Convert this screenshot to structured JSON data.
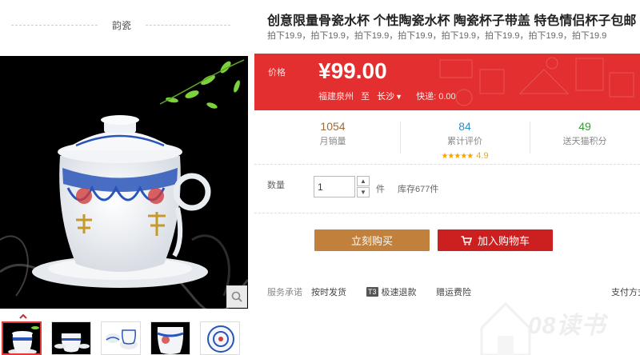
{
  "store": {
    "name": "韵瓷"
  },
  "product": {
    "title": "创意限量骨瓷水杯 个性陶瓷水杯 陶瓷杯子带盖 特色情侣杯子包邮",
    "subtitle": "拍下19.9，拍下19.9，拍下19.9，拍下19.9，拍下19.9，拍下19.9，拍下19.9，拍下19.9"
  },
  "price": {
    "label": "价格",
    "value": "¥99.00",
    "origin": "福建泉州",
    "to": "至",
    "destination": "长沙",
    "express": "快递: 0.00"
  },
  "stats": {
    "monthly_sales": {
      "value": "1054",
      "label": "月销量"
    },
    "reviews": {
      "value": "84",
      "label": "累计评价",
      "stars": "★★★★★",
      "rating": "4.9"
    },
    "points": {
      "value": "49",
      "label": "送天猫积分"
    }
  },
  "colors": {
    "price_bg": "#e32f2f",
    "buy_now": "#c1803b",
    "add_cart": "#cc1f1f",
    "stat_sales": "#9c6a3a",
    "stat_reviews": "#2f8fbf",
    "stat_points": "#3a9a3a"
  },
  "quantity": {
    "label": "数量",
    "value": "1",
    "unit": "件",
    "stock": "库存677件"
  },
  "actions": {
    "buy_now": "立刻购买",
    "add_to_cart": "加入购物车"
  },
  "service": {
    "label": "服务承诺",
    "items": [
      "按时发货",
      "极速退款",
      "赠运费险",
      "支付方式"
    ],
    "badge": "T3"
  },
  "watermark": {
    "text": "08读书"
  },
  "icons": [
    "zoom-icon",
    "arrow-up-icon",
    "cart-icon",
    "chevron-down-icon"
  ]
}
